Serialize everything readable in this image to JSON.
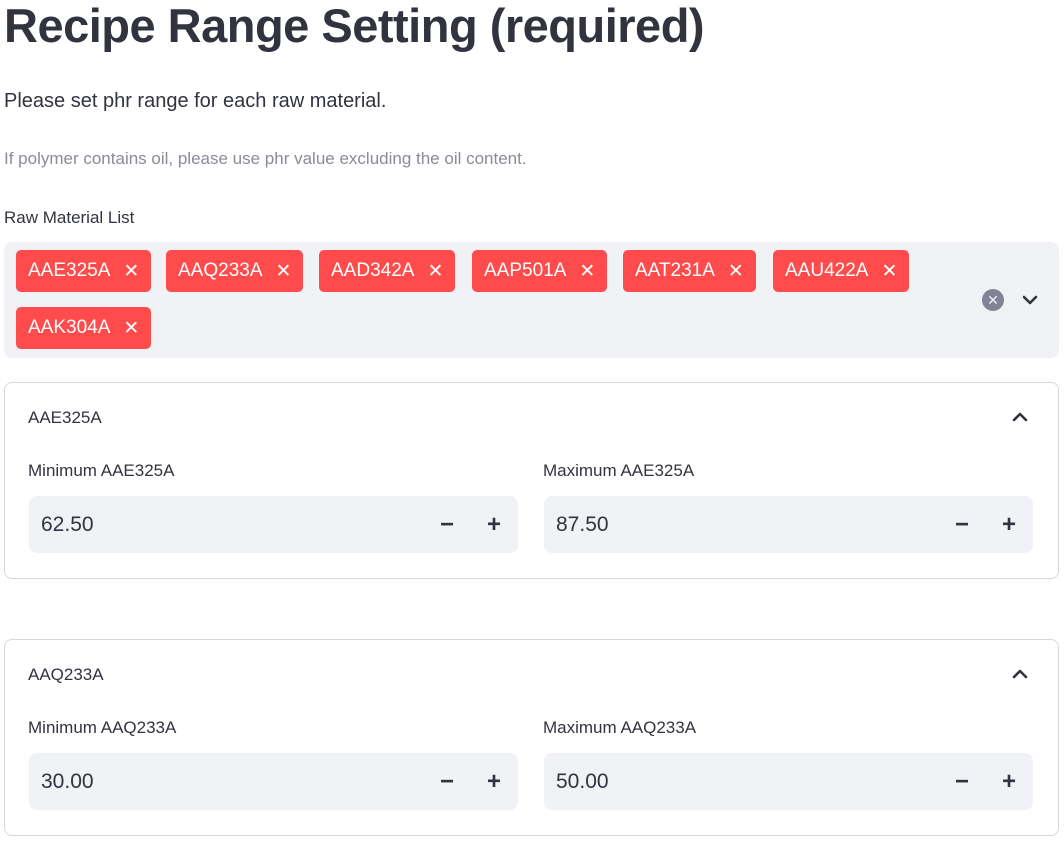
{
  "header": {
    "title": "Recipe Range Setting (required)",
    "subtitle": "Please set phr range for each raw material.",
    "caption": "If polymer contains oil, please use phr value excluding the oil content."
  },
  "raw_material_list": {
    "label": "Raw Material List",
    "selected": [
      {
        "label": "AAE325A",
        "remove": "✕"
      },
      {
        "label": "AAQ233A",
        "remove": "✕"
      },
      {
        "label": "AAD342A",
        "remove": "✕"
      },
      {
        "label": "AAP501A",
        "remove": "✕"
      },
      {
        "label": "AAT231A",
        "remove": "✕"
      },
      {
        "label": "AAU422A",
        "remove": "✕"
      },
      {
        "label": "AAK304A",
        "remove": "✕"
      }
    ],
    "clear_icon": "✕",
    "tag_color": "#ff4b4b"
  },
  "expanders": [
    {
      "title": "AAE325A",
      "min_label": "Minimum AAE325A",
      "min_value": "62.50",
      "max_label": "Maximum AAE325A",
      "max_value": "87.50"
    },
    {
      "title": "AAQ233A",
      "min_label": "Minimum AAQ233A",
      "min_value": "30.00",
      "max_label": "Maximum AAQ233A",
      "max_value": "50.00"
    }
  ],
  "stepper": {
    "minus": "−",
    "plus": "+"
  },
  "icons": {
    "dropdown": "chevron-down-icon",
    "collapse": "chevron-up-icon",
    "clear": "clear-all-icon"
  }
}
